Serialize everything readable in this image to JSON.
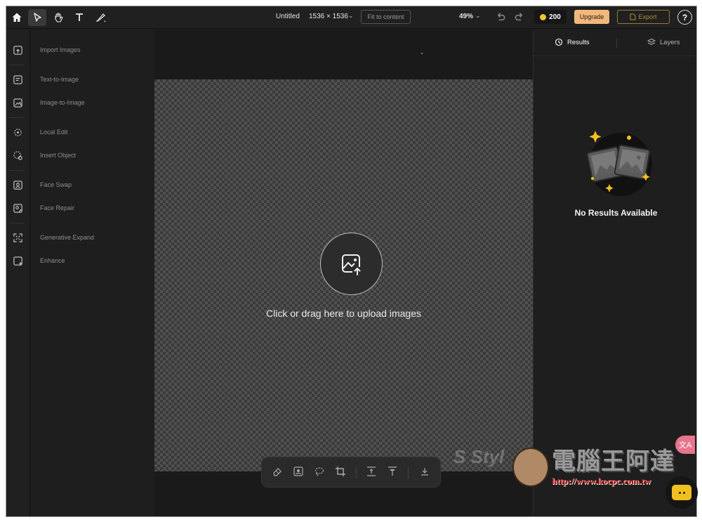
{
  "topbar": {
    "doc_title": "Untitled",
    "doc_size": "1536 × 1536",
    "fit_label": "Fit to content",
    "zoom": "49%",
    "credits": "200",
    "upgrade_label": "Upgrade",
    "export_label": "Export",
    "help_label": "?"
  },
  "sidebar": {
    "items": [
      {
        "label": "Import Images",
        "icon": "import-image-icon"
      },
      {
        "label": "Text-to-Image",
        "icon": "text-to-image-icon"
      },
      {
        "label": "Image-to-Image",
        "icon": "image-to-image-icon"
      },
      {
        "label": "Local Edit",
        "icon": "local-edit-icon"
      },
      {
        "label": "Insert Object",
        "icon": "insert-object-icon"
      },
      {
        "label": "Face Swap",
        "icon": "face-swap-icon"
      },
      {
        "label": "Face Repair",
        "icon": "face-repair-icon"
      },
      {
        "label": "Generative Expand",
        "icon": "generative-expand-icon"
      },
      {
        "label": "Enhance",
        "icon": "enhance-icon"
      }
    ]
  },
  "canvas": {
    "upload_text": "Click or drag here to upload images"
  },
  "right_panel": {
    "tabs": [
      {
        "label": "Results",
        "icon": "history-icon"
      },
      {
        "label": "Layers",
        "icon": "layers-icon"
      }
    ],
    "empty_text": "No Results Available"
  },
  "watermark": {
    "brand_text": "S Styl",
    "cn_text": "電腦王阿達",
    "url": "http://www.kocpc.com.tw"
  },
  "colors": {
    "accent": "#f0b87c",
    "export_border": "#9c7a2e",
    "coin": "#f2c230",
    "chat": "#f0c020"
  }
}
